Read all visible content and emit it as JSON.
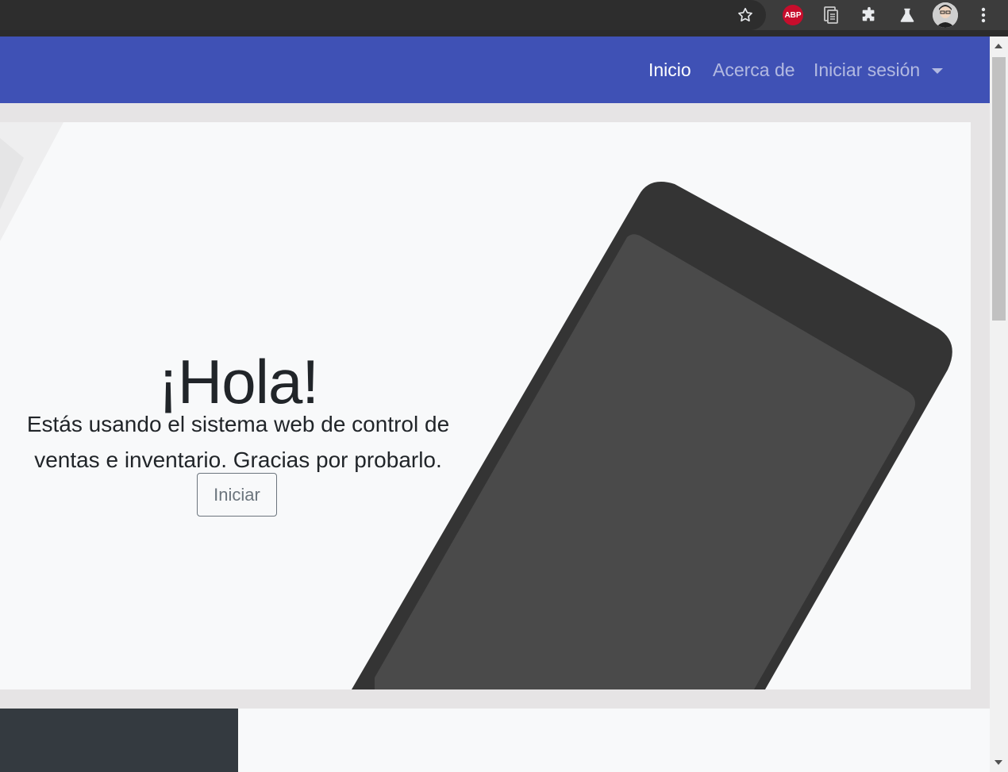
{
  "navbar": {
    "links": [
      {
        "label": "Inicio",
        "active": true
      },
      {
        "label": "Acerca de",
        "active": false
      },
      {
        "label": "Iniciar sesión",
        "active": false,
        "dropdown": true
      }
    ],
    "background": "#3f51b5"
  },
  "hero": {
    "title": "¡Hola!",
    "lead": "Estás usando el sistema web de control de ventas e inventario. Gracias por probarlo.",
    "button_label": "Iniciar"
  },
  "browser": {
    "extension_badge": "ABP",
    "icons": [
      "star-icon",
      "adblock-icon",
      "reader-icon",
      "extensions-icon",
      "labs-icon",
      "profile-avatar",
      "menu-icon"
    ]
  },
  "colors": {
    "navbar": "#3f51b5",
    "hero_bg": "#f8f9fa",
    "phone_frame": "#343434",
    "phone_screen": "#4a4a4a",
    "footer_dark": "#343a40"
  }
}
